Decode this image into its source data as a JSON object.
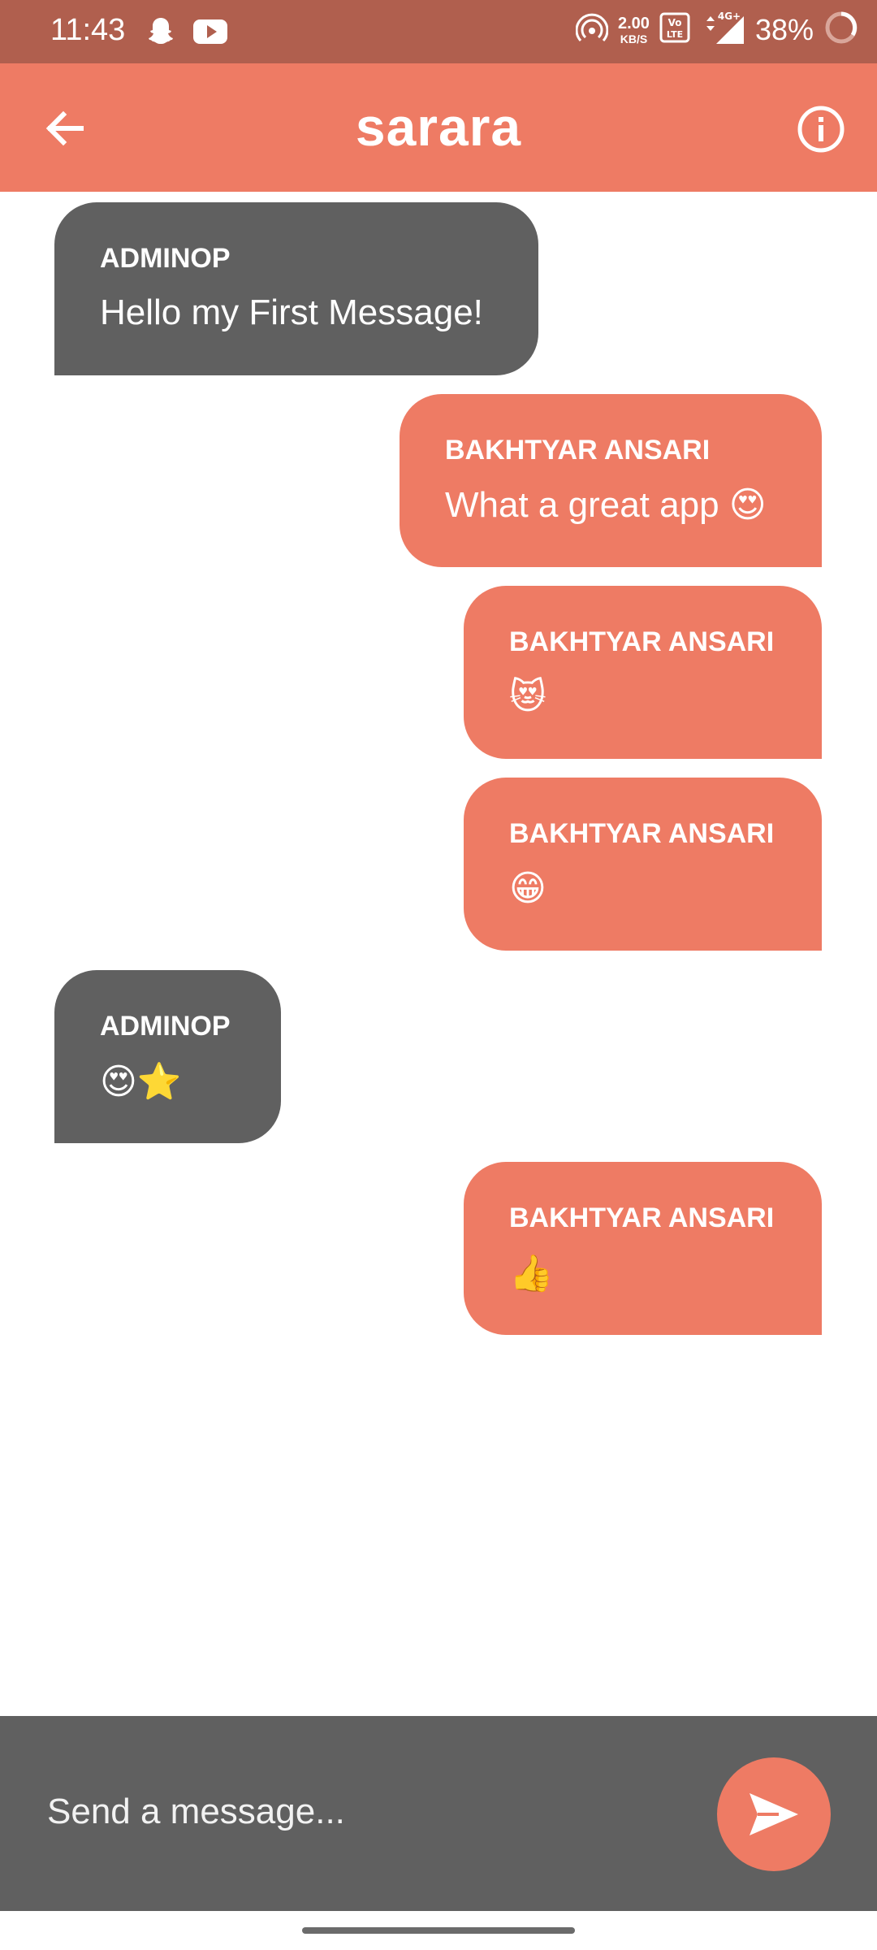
{
  "status_bar": {
    "time": "11:43",
    "speed_value": "2.00",
    "speed_unit": "KB/S",
    "network_badge": "VoLTE",
    "network_type": "4G+",
    "battery": "38%"
  },
  "app_bar": {
    "title": "sarara",
    "back_icon": "arrow-left-icon",
    "info_icon": "info-icon"
  },
  "messages": [
    {
      "sender": "ADMINOP",
      "text": "Hello my First Message!",
      "side": "received"
    },
    {
      "sender": "BAKHTYAR ANSARI",
      "text": "What a great app 😍",
      "side": "sent"
    },
    {
      "sender": "BAKHTYAR ANSARI",
      "text": "😻",
      "side": "sent"
    },
    {
      "sender": "BAKHTYAR ANSARI",
      "text": "😁",
      "side": "sent"
    },
    {
      "sender": "ADMINOP",
      "text": "😍⭐",
      "side": "received"
    },
    {
      "sender": "BAKHTYAR ANSARI",
      "text": "👍",
      "side": "sent"
    }
  ],
  "composer": {
    "placeholder": "Send a message...",
    "send_icon": "send-icon"
  },
  "colors": {
    "status_bar": "#b05f4e",
    "accent": "#ee7b64",
    "received_bubble": "#606060",
    "composer_bg": "#606060"
  }
}
